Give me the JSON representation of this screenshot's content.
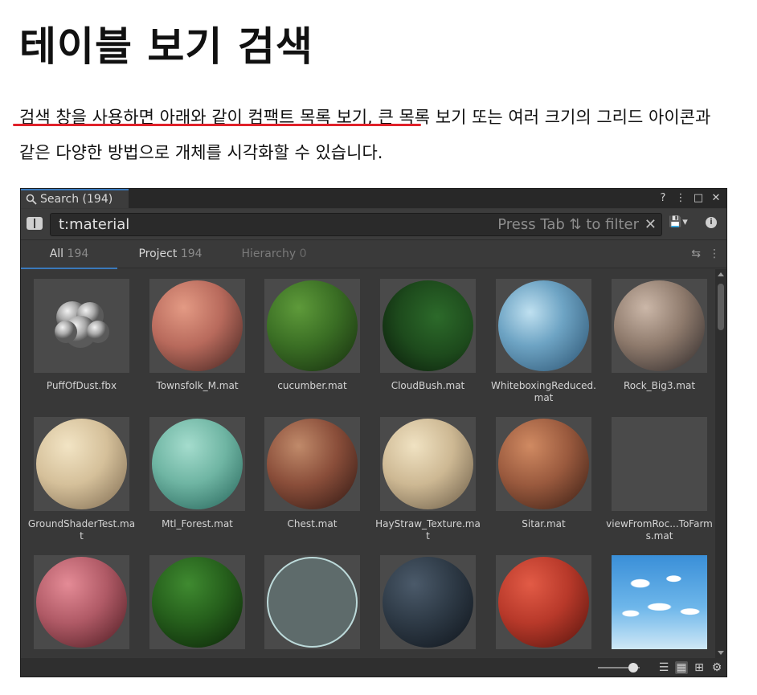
{
  "document": {
    "title": "테이블 보기 검색",
    "paragraph": "검색 창을 사용하면 아래와 같이 컴팩트 목록 보기, 큰 목록 보기 또는 여러 크기의 그리드 아이콘과 같은 다양한 방법으로 개체를 시각화할 수 있습니다.",
    "underline_color": "#e0212a"
  },
  "window": {
    "tab_label": "Search (194)",
    "search_value": "t:material",
    "search_hint": "Press Tab ⇅ to filter",
    "clear_glyph": "✕",
    "controls": {
      "help": "?",
      "menu": "⋮",
      "maximize": "□",
      "close": "✕"
    },
    "save_glyph": "💾",
    "save_arrow": "▾",
    "info_glyph": "i"
  },
  "tabs": [
    {
      "label": "All",
      "count": "194",
      "state": "active"
    },
    {
      "label": "Project",
      "count": "194",
      "state": "normal"
    },
    {
      "label": "Hierarchy",
      "count": "0",
      "state": "disabled"
    }
  ],
  "tab_tools": {
    "sync": "⇆",
    "more": "⋮"
  },
  "items": [
    {
      "name": "PuffOfDust.fbx",
      "preview": "mesh"
    },
    {
      "name": "Townsfolk_M.mat",
      "preview": "townsfolk"
    },
    {
      "name": "cucumber.mat",
      "preview": "cucumber"
    },
    {
      "name": "CloudBush.mat",
      "preview": "cloudbush"
    },
    {
      "name": "WhiteboxingReduced.mat",
      "preview": "whitebox"
    },
    {
      "name": "Rock_Big3.mat",
      "preview": "rock"
    },
    {
      "name": "GroundShaderTest.mat",
      "preview": "ground"
    },
    {
      "name": "Mtl_Forest.mat",
      "preview": "forest"
    },
    {
      "name": "Chest.mat",
      "preview": "chest"
    },
    {
      "name": "HayStraw_Texture.mat",
      "preview": "hay"
    },
    {
      "name": "Sitar.mat",
      "preview": "sitar"
    },
    {
      "name": "viewFromRoc...ToFarms.mat",
      "preview": "empty"
    },
    {
      "name": "",
      "preview": "pinkgreen"
    },
    {
      "name": "",
      "preview": "greenleaf"
    },
    {
      "name": "",
      "preview": "grayring"
    },
    {
      "name": "",
      "preview": "darkblue"
    },
    {
      "name": "",
      "preview": "redgreen"
    },
    {
      "name": "",
      "preview": "sky"
    }
  ],
  "status": {
    "zoom": 0.85,
    "view_list_compact": "☰",
    "view_grid": "▦",
    "view_table": "⊞",
    "settings": "⚙"
  }
}
